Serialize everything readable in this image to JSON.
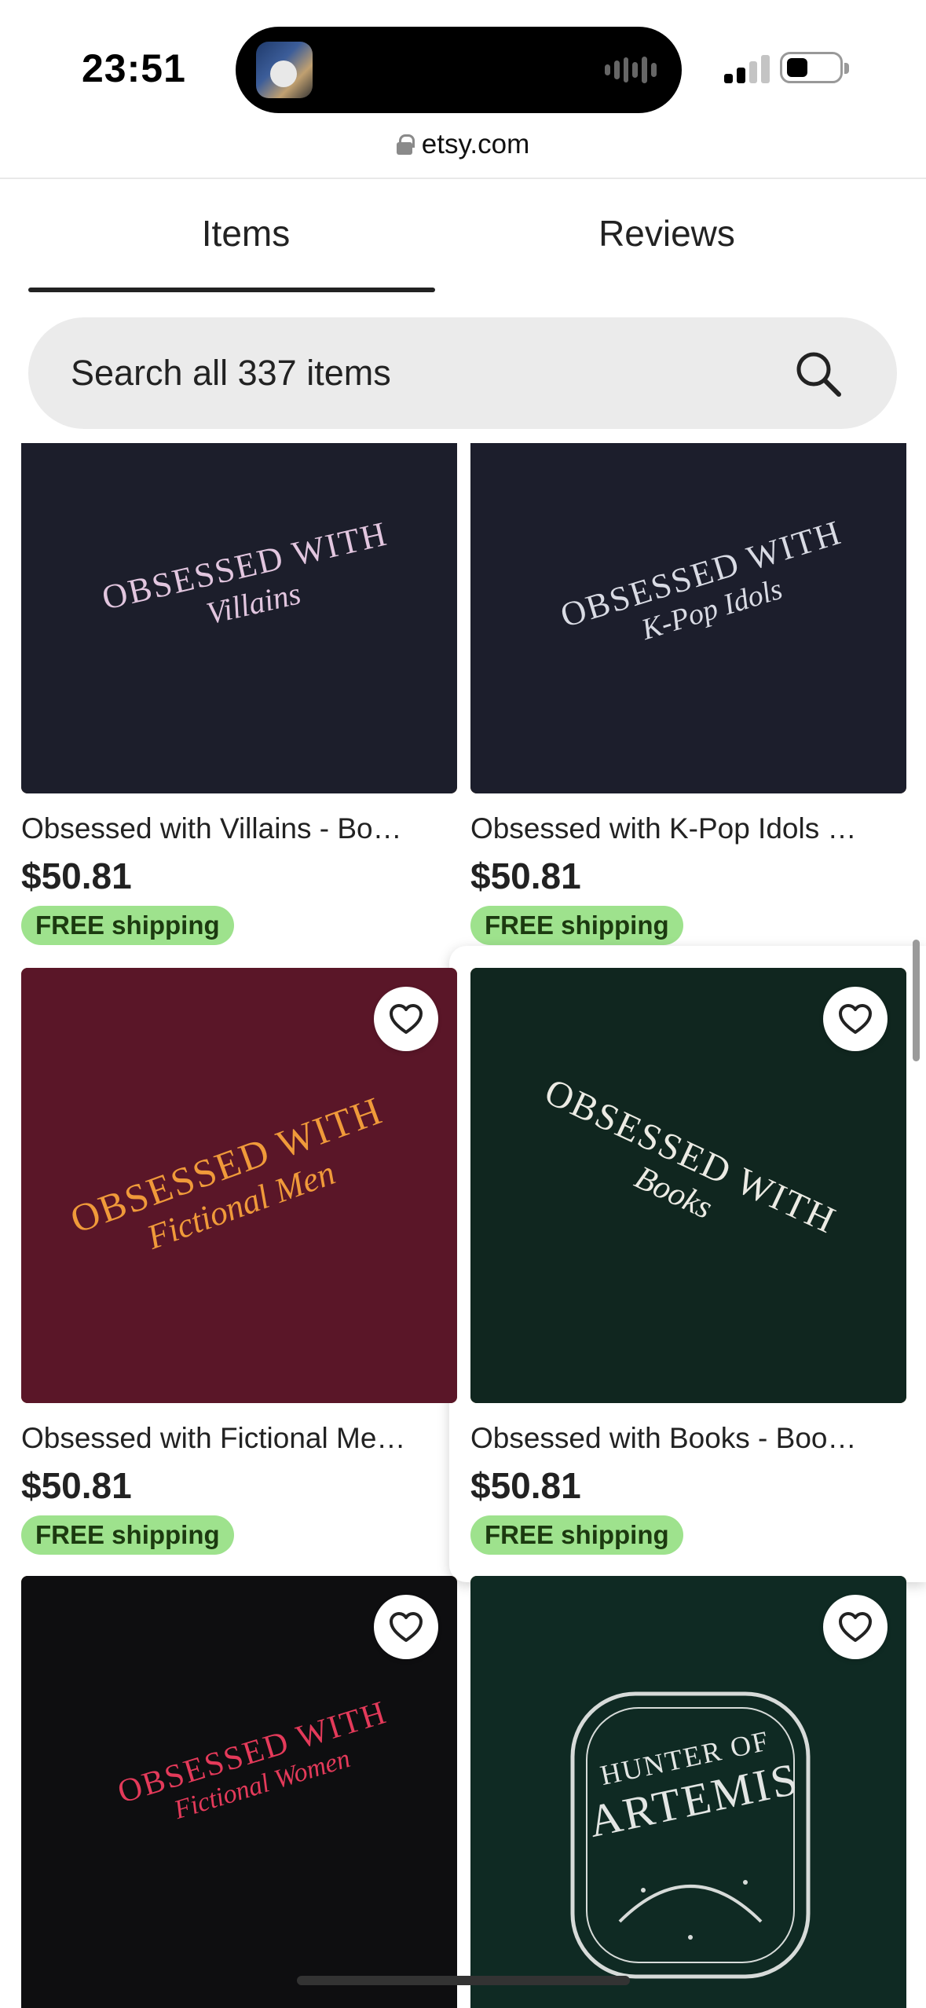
{
  "status_bar": {
    "time": "23:51",
    "url": "etsy.com"
  },
  "tabs": [
    {
      "label": "Items",
      "active": true
    },
    {
      "label": "Reviews",
      "active": false
    }
  ],
  "search": {
    "placeholder": "Search all 337 items"
  },
  "listings": [
    {
      "title": "Obsessed with Villains - Bo…",
      "price": "$50.81",
      "shipping": "FREE shipping",
      "shirt_color": "#1c1e2b",
      "emb_color": "#e2c6df",
      "emb_line1": "OBSESSED WITH",
      "emb_line2": "Villains"
    },
    {
      "title": "Obsessed with K-Pop Idols …",
      "price": "$50.81",
      "shipping": "FREE shipping",
      "shirt_color": "#1c1e2c",
      "emb_color": "#d9dbe4",
      "emb_line1": "OBSESSED WITH",
      "emb_line2": "K-Pop Idols"
    },
    {
      "title": "Obsessed with Fictional Me…",
      "price": "$50.81",
      "shipping": "FREE shipping",
      "shirt_color": "#5a1628",
      "emb_color": "#f09a3a",
      "emb_line1": "OBSESSED WITH",
      "emb_line2": "Fictional Men"
    },
    {
      "title": "Obsessed with Books - Boo…",
      "price": "$50.81",
      "shipping": "FREE shipping",
      "shirt_color": "#10261f",
      "emb_color": "#ecebe4",
      "emb_line1": "OBSESSED WITH",
      "emb_line2": "Books"
    },
    {
      "title": "",
      "price": "",
      "shipping": "",
      "shirt_color": "#0e0e10",
      "emb_color": "#e43a5a",
      "emb_line1": "OBSESSED WITH",
      "emb_line2": "Fictional Women"
    },
    {
      "title": "",
      "price": "",
      "shipping": "",
      "shirt_color": "#0f2a23",
      "emb_color": "#e3e6e4",
      "emb_line1": "HUNTER OF",
      "emb_line2": "ARTEMIS"
    }
  ],
  "colors": {
    "accent_underline": "#222222",
    "free_shipping_bg": "#9ee28d",
    "search_bg": "#ebebeb"
  }
}
